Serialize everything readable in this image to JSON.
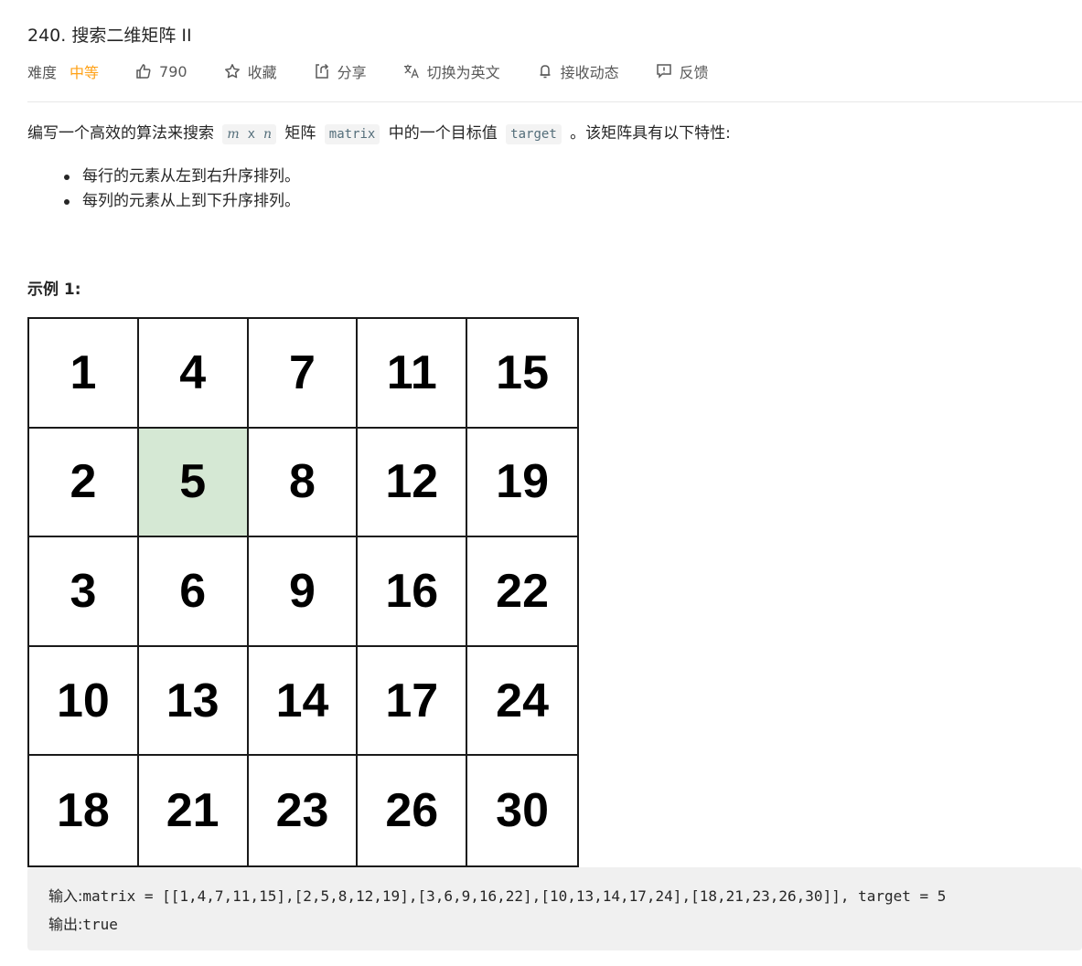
{
  "problem": {
    "title": "240. 搜索二维矩阵 II",
    "difficulty_label": "难度",
    "difficulty_value": "中等",
    "like_count": "790",
    "favorite_label": "收藏",
    "share_label": "分享",
    "translate_label": "切换为英文",
    "notify_label": "接收动态",
    "feedback_label": "反馈"
  },
  "description": {
    "part1": "编写一个高效的算法来搜索",
    "m": "m",
    "x": "x",
    "n": "n",
    "part2": "矩阵",
    "matrix_code": "matrix",
    "part3": "中的一个目标值",
    "target_code": "target",
    "part4": "。该矩阵具有以下特性:",
    "bullets": [
      "每行的元素从左到右升序排列。",
      "每列的元素从上到下升序排列。"
    ]
  },
  "example": {
    "heading": "示例 1:",
    "matrix": [
      [
        "1",
        "4",
        "7",
        "11",
        "15"
      ],
      [
        "2",
        "5",
        "8",
        "12",
        "19"
      ],
      [
        "3",
        "6",
        "9",
        "16",
        "22"
      ],
      [
        "10",
        "13",
        "14",
        "17",
        "24"
      ],
      [
        "18",
        "21",
        "23",
        "26",
        "30"
      ]
    ],
    "highlight_value": "5",
    "highlight_color": "#d5e8d4",
    "input_label": "输入:",
    "input_value": "matrix = [[1,4,7,11,15],[2,5,8,12,19],[3,6,9,16,22],[10,13,14,17,24],[18,21,23,26,30]], target = 5",
    "output_label": "输出:",
    "output_value": "true"
  },
  "icons": {
    "like": "thumbs-up-icon",
    "favorite": "star-icon",
    "share": "share-icon",
    "translate": "translate-icon",
    "notify": "bell-icon",
    "feedback": "feedback-icon"
  },
  "colors": {
    "difficulty": "#ffa116",
    "text": "#262626",
    "muted": "#595959"
  }
}
